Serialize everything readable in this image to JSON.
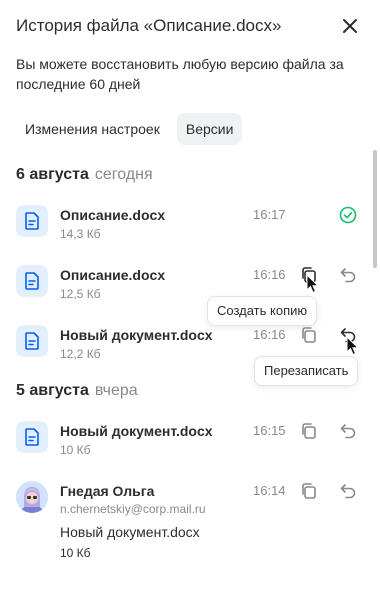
{
  "header": {
    "title": "История файла «Описание.docx»",
    "close_icon": "close-icon"
  },
  "description": "Вы можете восстановить любую версию файла за последние 60 дней",
  "tabs": [
    {
      "label": "Изменения настроек",
      "active": false
    },
    {
      "label": "Версии",
      "active": true
    }
  ],
  "groups": [
    {
      "date": "6 августа",
      "relative": "сегодня",
      "items": [
        {
          "name": "Описание.docx",
          "size": "14,3 Кб",
          "time": "16:17",
          "status": "current"
        },
        {
          "name": "Описание.docx",
          "size": "12,5 Кб",
          "time": "16:16",
          "status": "restorable"
        },
        {
          "name": "Новый документ.docx",
          "size": "12,2 Кб",
          "time": "16:16",
          "status": "restorable"
        }
      ]
    },
    {
      "date": "5 августа",
      "relative": "вчера",
      "items": [
        {
          "name": "Новый документ.docx",
          "size": "10 Кб",
          "time": "16:15",
          "status": "restorable"
        }
      ]
    }
  ],
  "user_entry": {
    "name": "Гнедая Ольга",
    "email": "n.chernetskiy@corp.mail.ru",
    "time": "16:14",
    "document": "Новый документ.docx",
    "size": "10 Кб"
  },
  "tooltips": {
    "copy": "Создать копию",
    "overwrite": "Перезаписать"
  },
  "colors": {
    "accent_bg": "#e4effd",
    "icon_blue": "#005ff9",
    "success": "#0dc268",
    "muted": "#87898f"
  }
}
